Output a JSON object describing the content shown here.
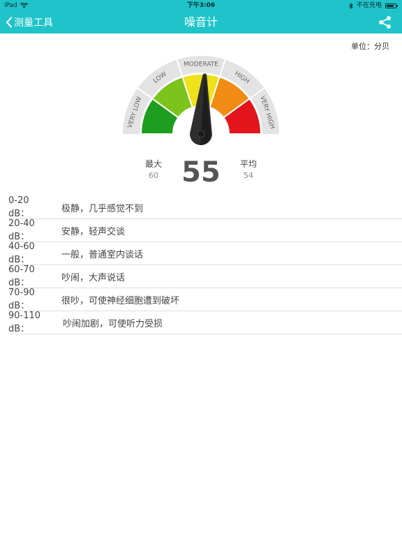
{
  "status_bar": {
    "device": "iPad",
    "time": "下午3:06",
    "charging": "不在充电",
    "battery_level": 0.8
  },
  "nav": {
    "back_label": "测量工具",
    "title": "噪音计"
  },
  "unit_label": "单位：分贝",
  "gauge": {
    "segments": [
      {
        "label": "VERY LOW",
        "color": "#1e9e1e"
      },
      {
        "label": "LOW",
        "color": "#7cc41c"
      },
      {
        "label": "MODERATE",
        "color": "#efe11a"
      },
      {
        "label": "HIGH",
        "color": "#f08c14"
      },
      {
        "label": "VERY HIGH",
        "color": "#e4141c"
      }
    ],
    "needle_fraction": 0.52
  },
  "readout": {
    "max_label": "最大",
    "max_value": "60",
    "current": "55",
    "avg_label": "平均",
    "avg_value": "54"
  },
  "levels": [
    {
      "range": "0-20 dB：",
      "desc": "极静，几乎感觉不到"
    },
    {
      "range": "20-40 dB：",
      "desc": "安静，轻声交谈"
    },
    {
      "range": "40-60 dB：",
      "desc": "一般，普通室内谈话"
    },
    {
      "range": "60-70 dB：",
      "desc": "吵闹，大声说话"
    },
    {
      "range": "70-90 dB：",
      "desc": "很吵，可使神经细胞遭到破坏"
    },
    {
      "range": "90-110 dB：",
      "desc": "吵闹加剧，可使听力受损"
    }
  ]
}
